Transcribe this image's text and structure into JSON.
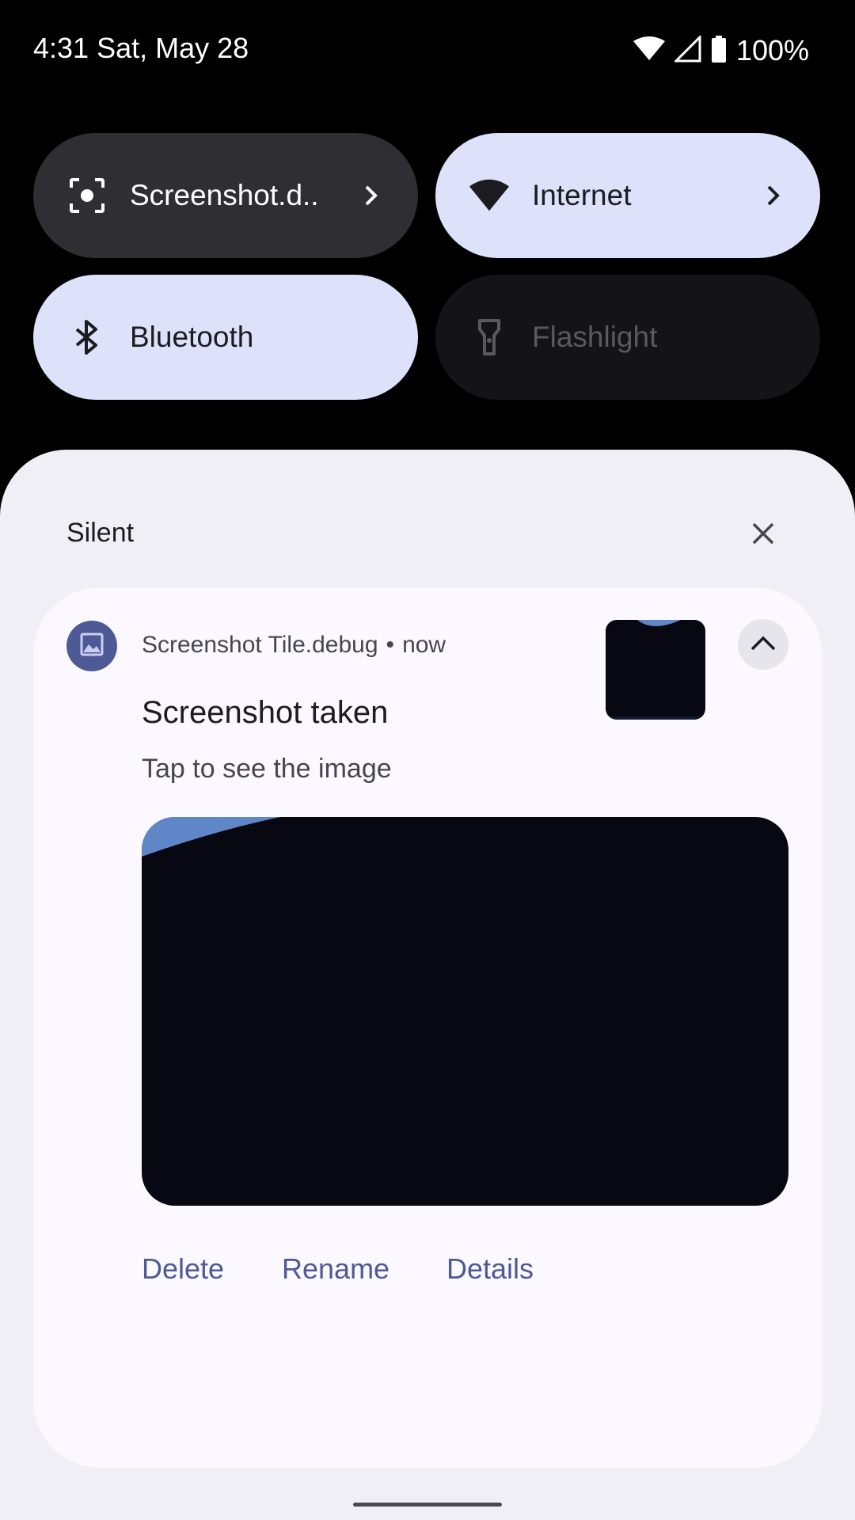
{
  "status_bar": {
    "time": "4:31",
    "date": "Sat, May 28",
    "battery": "100%",
    "icons": [
      "wifi-icon",
      "cell-signal-icon",
      "battery-icon"
    ]
  },
  "quick_tiles": [
    {
      "label": "Screenshot.d..",
      "icon": "screenshot-icon",
      "state": "off-with-detail"
    },
    {
      "label": "Internet",
      "icon": "wifi-icon",
      "state": "on"
    },
    {
      "label": "Bluetooth",
      "icon": "bluetooth-icon",
      "state": "on"
    },
    {
      "label": "Flashlight",
      "icon": "flashlight-icon",
      "state": "unavailable"
    }
  ],
  "notifications": {
    "section_title": "Silent",
    "clear_icon": "close-icon",
    "card": {
      "app_name": "Screenshot Tile.debug",
      "separator": "•",
      "time": "now",
      "title": "Screenshot taken",
      "text": "Tap to see the image",
      "actions": [
        "Delete",
        "Rename",
        "Details"
      ]
    }
  },
  "colors": {
    "accent": "#4e5a95",
    "tile_on": "#dde1fa",
    "tile_dark": "#2f2f33",
    "shade_bg": "#f0eff5",
    "card_bg": "#fbf8ff"
  }
}
